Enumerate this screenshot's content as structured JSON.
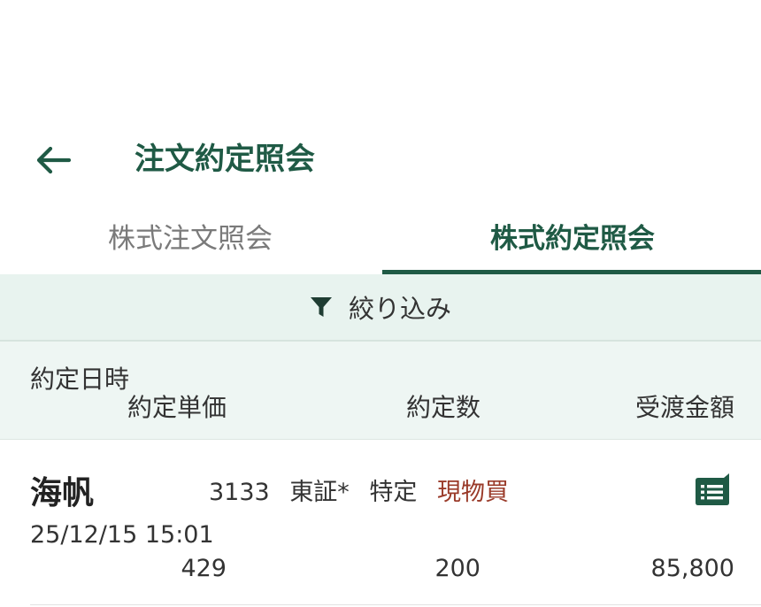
{
  "header": {
    "title": "注文約定照会",
    "back_icon": "arrow-left-icon"
  },
  "tabs": [
    {
      "label": "株式注文照会",
      "active": false
    },
    {
      "label": "株式約定照会",
      "active": true
    }
  ],
  "filter": {
    "label": "絞り込み",
    "icon": "funnel-icon"
  },
  "columns": {
    "datetime": "約定日時",
    "unit_price": "約定単価",
    "quantity": "約定数",
    "amount": "受渡金額"
  },
  "executions": [
    {
      "name": "海帆",
      "code": "3133",
      "market": "東証*",
      "account": "特定",
      "side": "現物買",
      "datetime": "25/12/15 15:01",
      "unit_price": "429",
      "quantity": "200",
      "amount": "85,800",
      "detail_icon": "detail-list-icon"
    }
  ],
  "colors": {
    "accent": "#1f5a45",
    "filter_bg": "#e8f3ef",
    "buy": "#9a3b2a"
  }
}
